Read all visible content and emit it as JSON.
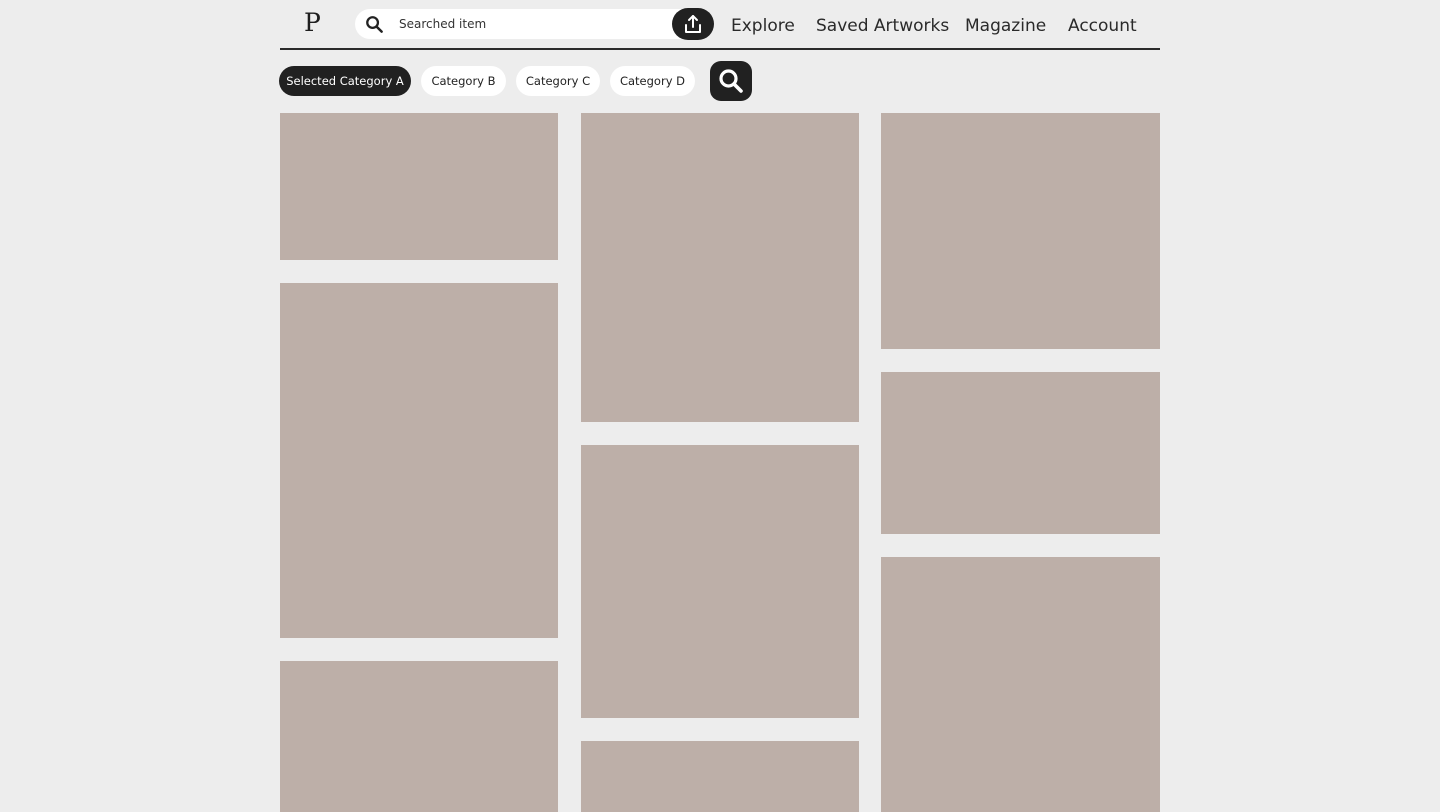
{
  "brand": {
    "logo": "P"
  },
  "search": {
    "value": "Searched item"
  },
  "nav": {
    "items": [
      "Explore",
      "Saved Artworks",
      "Magazine",
      "Account"
    ]
  },
  "categories": [
    {
      "label": "Selected Category A",
      "selected": true
    },
    {
      "label": "Category B",
      "selected": false
    },
    {
      "label": "Category C",
      "selected": false
    },
    {
      "label": "Category D",
      "selected": false
    }
  ],
  "icons": {
    "search": "search-icon",
    "upload": "upload-icon",
    "filter_search": "search-icon"
  },
  "colors": {
    "background": "#ededed",
    "tile": "#bdafa8",
    "accent_dark": "#212121",
    "chip_background": "#ffffff"
  }
}
